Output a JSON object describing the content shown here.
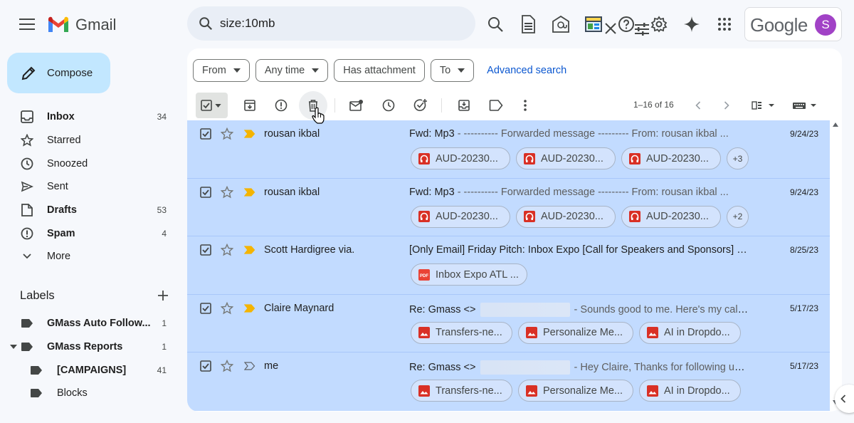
{
  "app": {
    "name": "Gmail",
    "google_label": "Google",
    "avatar_letter": "S",
    "avatar_color": "#a142c6"
  },
  "search": {
    "query": "size:10mb"
  },
  "top_icons": [
    "search-icon",
    "document-icon",
    "mail-at-icon",
    "calendar-panel-icon",
    "help-icon",
    "settings-icon",
    "gemini-sparkle-icon",
    "apps-grid-icon"
  ],
  "sidebar": {
    "compose_label": "Compose",
    "items": [
      {
        "label": "Inbox",
        "count": "34",
        "icon": "inbox-icon",
        "bold": true
      },
      {
        "label": "Starred",
        "count": "",
        "icon": "star-icon",
        "bold": false
      },
      {
        "label": "Snoozed",
        "count": "",
        "icon": "clock-icon",
        "bold": false
      },
      {
        "label": "Sent",
        "count": "",
        "icon": "send-icon",
        "bold": false
      },
      {
        "label": "Drafts",
        "count": "53",
        "icon": "draft-icon",
        "bold": true
      },
      {
        "label": "Spam",
        "count": "4",
        "icon": "spam-icon",
        "bold": true
      },
      {
        "label": "More",
        "count": "",
        "icon": "chevron-down-icon",
        "bold": false
      }
    ],
    "labels_title": "Labels",
    "labels": [
      {
        "name": "GMass Auto Follow...",
        "count": "1"
      },
      {
        "name": "GMass Reports",
        "count": "1"
      },
      {
        "name": "[CAMPAIGNS]",
        "count": "41"
      },
      {
        "name": "Blocks",
        "count": ""
      }
    ]
  },
  "filters": {
    "chips": [
      "From",
      "Any time",
      "Has attachment",
      "To"
    ],
    "advanced_search": "Advanced search"
  },
  "toolbar": {
    "icons": [
      "archive-icon",
      "report-spam-icon",
      "delete-icon",
      "mark-unread-icon",
      "snooze-icon",
      "add-task-icon",
      "move-to-icon",
      "label-icon",
      "more-vert-icon"
    ],
    "pager": "1–16 of 16"
  },
  "emails": [
    {
      "sender": "rousan ikbal",
      "subject": "Fwd: Mp3",
      "snippet": " - ---------- Forwarded message --------- From: rousan ikbal ...",
      "redacted": false,
      "date": "9/24/23",
      "important": true,
      "attachments": [
        {
          "name": "AUD-20230...",
          "type": "audio"
        },
        {
          "name": "AUD-20230...",
          "type": "audio"
        },
        {
          "name": "AUD-20230...",
          "type": "audio"
        }
      ],
      "more": "+3"
    },
    {
      "sender": "rousan ikbal",
      "subject": "Fwd: Mp3",
      "snippet": " - ---------- Forwarded message --------- From: rousan ikbal ...",
      "redacted": false,
      "date": "9/24/23",
      "important": true,
      "attachments": [
        {
          "name": "AUD-20230...",
          "type": "audio"
        },
        {
          "name": "AUD-20230...",
          "type": "audio"
        },
        {
          "name": "AUD-20230...",
          "type": "audio"
        }
      ],
      "more": "+2"
    },
    {
      "sender": "Scott Hardigree via.",
      "subject": "[Only Email] Friday Pitch: Inbox Expo [Call for Speakers and Sponsors]",
      "snippet": " - S...",
      "redacted": false,
      "date": "8/25/23",
      "important": true,
      "attachments": [
        {
          "name": "Inbox Expo ATL ...",
          "type": "pdf"
        }
      ],
      "more": ""
    },
    {
      "sender": "Claire Maynard",
      "subject": "Re: Gmass <>",
      "snippet": " - Sounds good to me. Here's my calen...",
      "redacted": true,
      "date": "5/17/23",
      "important": true,
      "attachments": [
        {
          "name": "Transfers-ne...",
          "type": "image"
        },
        {
          "name": "Personalize Me...",
          "type": "image"
        },
        {
          "name": "AI in Dropdo...",
          "type": "image"
        }
      ],
      "more": ""
    },
    {
      "sender": "me",
      "subject": "Re: Gmass <>",
      "snippet": " - Hey Claire, Thanks for following up. Y...",
      "redacted": true,
      "date": "5/17/23",
      "important": false,
      "attachments": [
        {
          "name": "Transfers-ne...",
          "type": "image"
        },
        {
          "name": "Personalize Me...",
          "type": "image"
        },
        {
          "name": "AI in Dropdo...",
          "type": "image"
        }
      ],
      "more": ""
    }
  ],
  "colors": {
    "selected_row": "#c2dbff",
    "compose_bg": "#c2e7ff",
    "link": "#0b57d0",
    "important": "#f4b400",
    "attachment_red": "#d93025"
  }
}
